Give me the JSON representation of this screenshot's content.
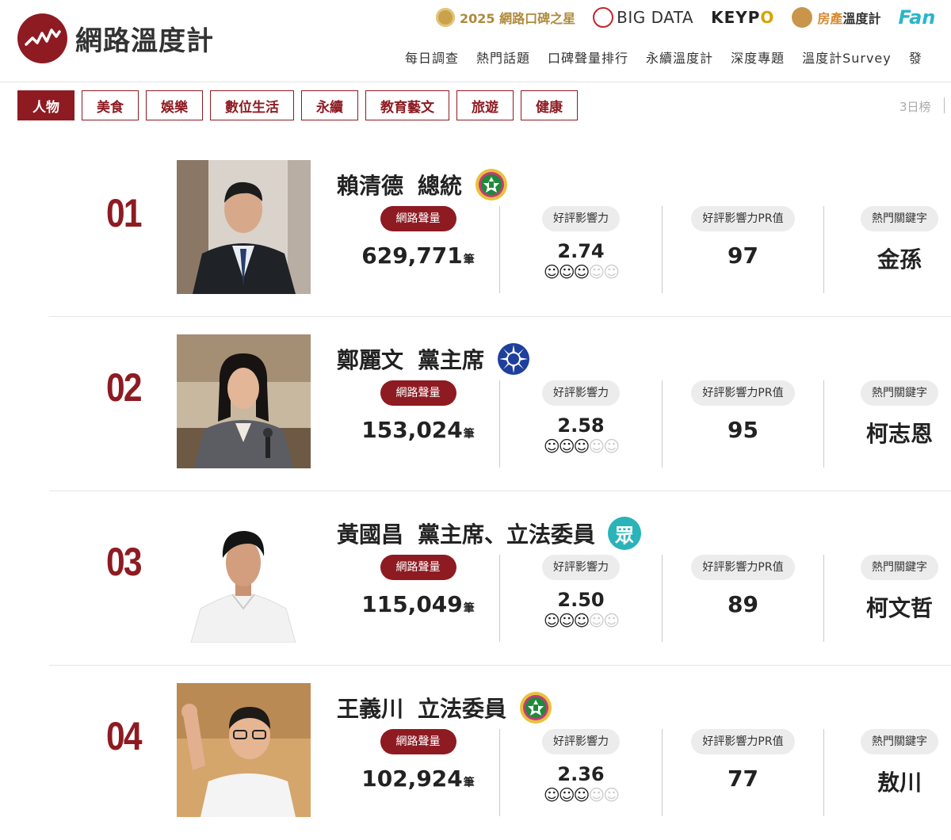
{
  "header": {
    "site_name": "網路溫度計",
    "partners": [
      {
        "label": "2025 網路口碑之星",
        "icon": "award-medal-icon"
      },
      {
        "label": "BIG DATA",
        "icon": "bigdata-logo-icon"
      },
      {
        "label_a": "KEYP",
        "label_b": "O",
        "icon": "keypo-logo"
      },
      {
        "label_a": "房產",
        "label_b": "溫度計",
        "icon": "house-thermometer-logo-icon"
      },
      {
        "label": "Fan",
        "icon": "fanpage-logo"
      }
    ],
    "nav": [
      "每日調查",
      "熱門話題",
      "口碑聲量排行",
      "永續溫度計",
      "深度專題",
      "溫度計Survey",
      "發"
    ]
  },
  "categories": [
    "人物",
    "美食",
    "娛樂",
    "數位生活",
    "永續",
    "教育藝文",
    "旅遊",
    "健康"
  ],
  "active_category": "人物",
  "range_label": "3日榜",
  "labels": {
    "volume": "網路聲量",
    "influence": "好評影響力",
    "pr": "好評影響力PR值",
    "keyword": "熱門關鍵字",
    "unit": "筆"
  },
  "colors": {
    "accent": "#8e1b22",
    "dpp_green": "#1f8a3a",
    "kmt_blue": "#1e3f9b",
    "tpp_teal": "#2ab3b8"
  },
  "ranking": [
    {
      "rank": "01",
      "name": "賴清德",
      "title": "總統",
      "party_icon": "dpp-party-icon",
      "volume": "629,771",
      "influence": "2.74",
      "faces_on": 3,
      "pr": "97",
      "keyword": "金孫"
    },
    {
      "rank": "02",
      "name": "鄭麗文",
      "title": "黨主席",
      "party_icon": "kmt-party-icon",
      "volume": "153,024",
      "influence": "2.58",
      "faces_on": 3,
      "pr": "95",
      "keyword": "柯志恩"
    },
    {
      "rank": "03",
      "name": "黃國昌",
      "title": "黨主席、立法委員",
      "party_icon": "tpp-party-icon",
      "party_text": "眾",
      "volume": "115,049",
      "influence": "2.50",
      "faces_on": 3,
      "pr": "89",
      "keyword": "柯文哲"
    },
    {
      "rank": "04",
      "name": "王義川",
      "title": "立法委員",
      "party_icon": "dpp-party-icon",
      "volume": "102,924",
      "influence": "2.36",
      "faces_on": 3,
      "pr": "77",
      "keyword": "敖川"
    }
  ]
}
